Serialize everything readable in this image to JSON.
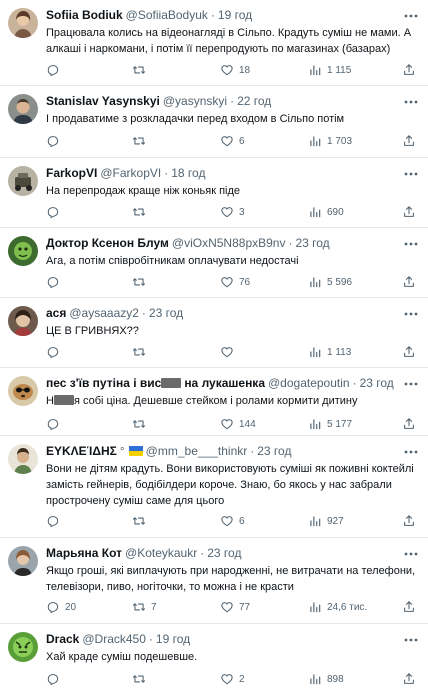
{
  "icons": {
    "reply": "reply-icon",
    "retweet": "retweet-icon",
    "like": "like-icon",
    "views": "views-icon",
    "share": "share-icon",
    "more": "more-icon"
  },
  "colors": {
    "text": "#0f1419",
    "muted": "#536471",
    "divider": "#e6e9ea"
  },
  "tweets": [
    {
      "name": "Sofiia Bodiuk",
      "handle": "@SofiiaBodyuk",
      "time": "19 год",
      "text": "Працювала колись на відеонагляді в Сільпо. Крадуть суміш не мами. А алкаші і наркомани, і потім її перепродують по магазинах (базарах)",
      "reply_count": "",
      "retweet_count": "",
      "like_count": "18",
      "views_count": "1 115"
    },
    {
      "name": "Stanislav Yasynskyi",
      "handle": "@yasynskyi",
      "time": "22 год",
      "text": "І продаватиме з розкладачки перед входом в Сільпо потім",
      "reply_count": "",
      "retweet_count": "",
      "like_count": "6",
      "views_count": "1 703"
    },
    {
      "name": "FarkopVI",
      "handle": "@FarkopVI",
      "time": "18 год",
      "text": "На перепродаж краще ніж коньяк піде",
      "reply_count": "",
      "retweet_count": "",
      "like_count": "3",
      "views_count": "690"
    },
    {
      "name": "Доктор Ксенон Блум",
      "handle": "@viOxN5N88pxB9nv",
      "time": "23 год",
      "text": "Ага, а потім співробітникам оплачувати недостачі",
      "reply_count": "",
      "retweet_count": "",
      "like_count": "76",
      "views_count": "5 596"
    },
    {
      "name": "ася",
      "handle": "@aysaaazy2",
      "time": "23 год",
      "text": "ЦЕ В ГРИВНЯХ??",
      "reply_count": "",
      "retweet_count": "",
      "like_count": "",
      "views_count": "1 113"
    },
    {
      "name_part1": "пес з'їв путіна і вис",
      "name_part2": "на лукашенка",
      "handle": "@dogatepoutin",
      "time": "23 год",
      "text_part1": "Н",
      "text_part2": "я собі ціна. Дешевше стейком і ролами кормити дитину",
      "reply_count": "",
      "retweet_count": "",
      "like_count": "144",
      "views_count": "5 177"
    },
    {
      "name": "ΕΥΚΛΕΊΔΗΣ",
      "name_suffix": "°",
      "handle": "@mm_be___thinkr",
      "time": "23 год",
      "text": "Вони не дітям крадуть. Вони використовують суміші як поживні коктейлі замість гейнерів, бодібілдери короче. Знаю, бо якось у нас забрали прострочену суміш саме для цього",
      "reply_count": "",
      "retweet_count": "",
      "like_count": "6",
      "views_count": "927"
    },
    {
      "name": "Марьяна Кот",
      "handle": "@Koteykaukr",
      "time": "23 год",
      "text": "Якщо гроші, які виплачують при народженні, не витрачати на телефони, телевізори, пиво, ногіточки, то можна і не красти",
      "reply_count": "20",
      "retweet_count": "7",
      "like_count": "77",
      "views_count": "24,6 тис."
    },
    {
      "name": "Drack",
      "handle": "@Drack450",
      "time": "19 год",
      "text": "Хай краде суміш подешевше.",
      "reply_count": "",
      "retweet_count": "",
      "like_count": "2",
      "views_count": "898"
    }
  ]
}
